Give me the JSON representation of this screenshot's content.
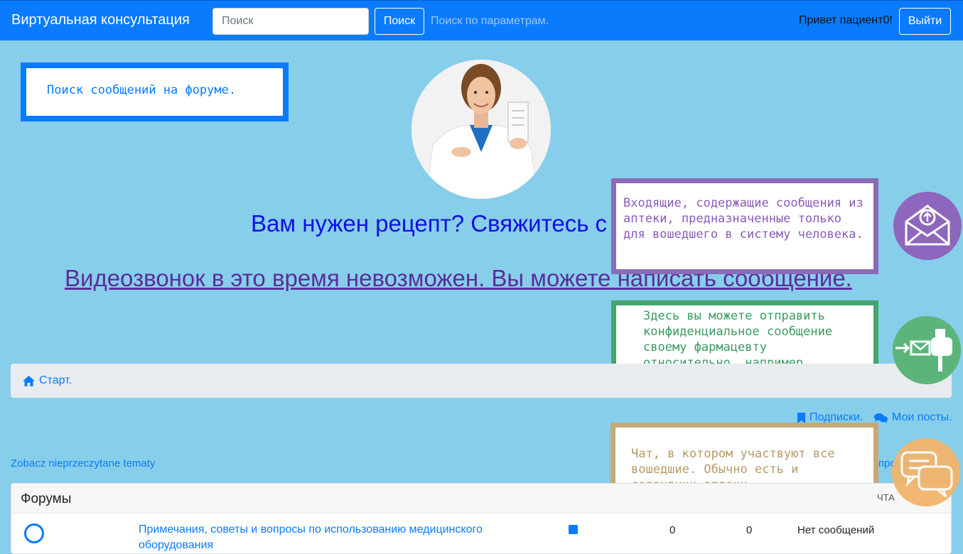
{
  "navbar": {
    "brand": "Виртуальная консультация",
    "search_placeholder": "Поиск",
    "search_button": "Поиск",
    "advanced_search": "Поиск по параметрам.",
    "greeting": "Привет пациент0!",
    "logout": "Выйти"
  },
  "tooltips": {
    "search": "Поиск сообщений на форуме.",
    "inbox": "Входящие, содержащие сообщения из аптеки, предназначенные только для вошедшего в систему человека.",
    "send": "Здесь вы можете отправить конфиденциальное сообщение своему фармацевту относительно, например, написания рецепта.",
    "chat": "Чат, в котором участвуют все вошедшие. Обычно есть и сотрудник аптеки."
  },
  "hero": {
    "headline": "Вам нужен рецепт? Свяжитесь с",
    "video_link": "Видеозвонок в это время невозможен. Вы можете написать сообщение."
  },
  "breadcrumb": {
    "start": "Старт."
  },
  "links": {
    "subscriptions": "Подписки.",
    "my_posts": "Мои посты.",
    "unread_topics": "Zobacz nieprzeczytane tematy",
    "mark_read": "прочитанные."
  },
  "forums": {
    "header": "Форумы",
    "col_last_post": "ЧТА",
    "rows": [
      {
        "name": "Примечания, советы и вопросы по использованию медицинского оборудования",
        "topics": "0",
        "posts": "0",
        "last": "Нет сообщений"
      }
    ]
  },
  "colors": {
    "navbar": "#0a7bfd",
    "background": "#87ceeb",
    "inbox": "#8e66bd",
    "send": "#5bb57b",
    "chat": "#f2b56c"
  },
  "icons": [
    "home-icon",
    "bookmark-icon",
    "comments-icon",
    "rss-icon",
    "envelope-upload-icon",
    "mailbox-send-icon",
    "chat-bubbles-icon"
  ]
}
